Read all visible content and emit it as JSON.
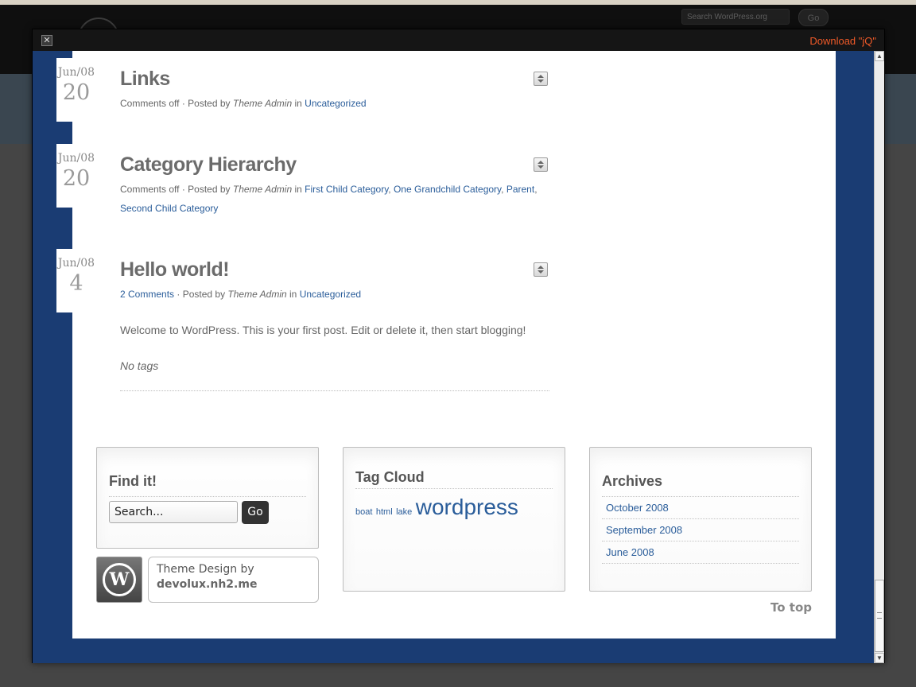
{
  "background": {
    "search_placeholder": "Search WordPress.org",
    "search_go": "Go"
  },
  "modal": {
    "close_symbol": "✕",
    "download_label": "Download \"jQ\""
  },
  "posts": [
    {
      "month": "Jun/08",
      "day": "20",
      "title": "Links",
      "comments": "Comments off",
      "posted_by": "Posted by",
      "author": "Theme Admin",
      "in": "in",
      "categories": [
        "Uncategorized"
      ]
    },
    {
      "month": "Jun/08",
      "day": "20",
      "title": "Category Hierarchy",
      "comments": "Comments off",
      "posted_by": "Posted by",
      "author": "Theme Admin",
      "in": "in",
      "categories": [
        "First Child Category",
        "One Grandchild Category",
        "Parent",
        "Second Child Category"
      ]
    },
    {
      "month": "Jun/08",
      "day": "4",
      "title": "Hello world!",
      "comments": "2 Comments",
      "posted_by": "Posted by",
      "author": "Theme Admin",
      "in": "in",
      "categories": [
        "Uncategorized"
      ],
      "excerpt": "Welcome to WordPress. This is your first post. Edit or delete it, then start blogging!",
      "tags": "No tags"
    }
  ],
  "widgets": {
    "find": {
      "title": "Find it!",
      "search_value": "Search...",
      "go_label": "Go"
    },
    "tag_cloud": {
      "title": "Tag Cloud",
      "tags": [
        "boat",
        "html",
        "lake",
        "wordpress"
      ]
    },
    "archives": {
      "title": "Archives",
      "items": [
        "October 2008",
        "September 2008",
        "June 2008"
      ]
    }
  },
  "credit": {
    "logo_letter": "W",
    "line1": "Theme Design by",
    "line2": "devolux.nh2.me"
  },
  "to_top": "To top",
  "colors": {
    "link": "#2a5d9a",
    "frame_blue": "#1a3c73",
    "download": "#f05a28"
  }
}
